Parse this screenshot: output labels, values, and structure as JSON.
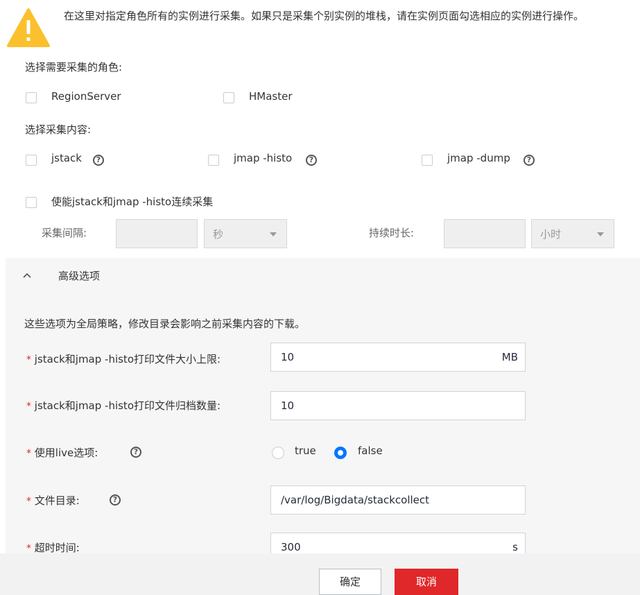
{
  "warning": {
    "icon": "warning-icon",
    "text": "在这里对指定角色所有的实例进行采集。如果只是采集个别实例的堆栈，请在实例页面勾选相应的实例进行操作。"
  },
  "roles": {
    "label": "选择需要采集的角色:",
    "items": [
      {
        "label": "RegionServer",
        "checked": false
      },
      {
        "label": "HMaster",
        "checked": false
      }
    ]
  },
  "content": {
    "label": "选择采集内容:",
    "items": [
      {
        "label": "jstack",
        "checked": false
      },
      {
        "label": "jmap -histo",
        "checked": false
      },
      {
        "label": "jmap -dump",
        "checked": false
      }
    ],
    "continuous": {
      "label": "使能jstack和jmap -histo连续采集",
      "checked": false
    }
  },
  "interval": {
    "label": "采集间隔:",
    "value": "",
    "unit": "秒"
  },
  "duration": {
    "label": "持续时长:",
    "value": "",
    "unit": "小时"
  },
  "advanced": {
    "title": "高级选项",
    "note": "这些选项为全局策略，修改目录会影响之前采集内容的下载。",
    "required_mark": "*",
    "fields": {
      "size_limit": {
        "label": "jstack和jmap -histo打印文件大小上限:",
        "value": "10",
        "unit": "MB"
      },
      "archive_count": {
        "label": "jstack和jmap -histo打印文件归档数量:",
        "value": "10"
      },
      "live": {
        "label": "使用live选项:",
        "options": [
          "true",
          "false"
        ],
        "selected": "false"
      },
      "directory": {
        "label": "文件目录:",
        "value": "/var/log/Bigdata/stackcollect"
      },
      "timeout": {
        "label": "超时时间:",
        "value": "300",
        "unit": "s"
      }
    }
  },
  "footer": {
    "ok_label": "确定",
    "cancel_label": "取消"
  },
  "colors": {
    "accent": "#0077ff",
    "danger": "#e0272a",
    "warning": "#fbc02d"
  }
}
